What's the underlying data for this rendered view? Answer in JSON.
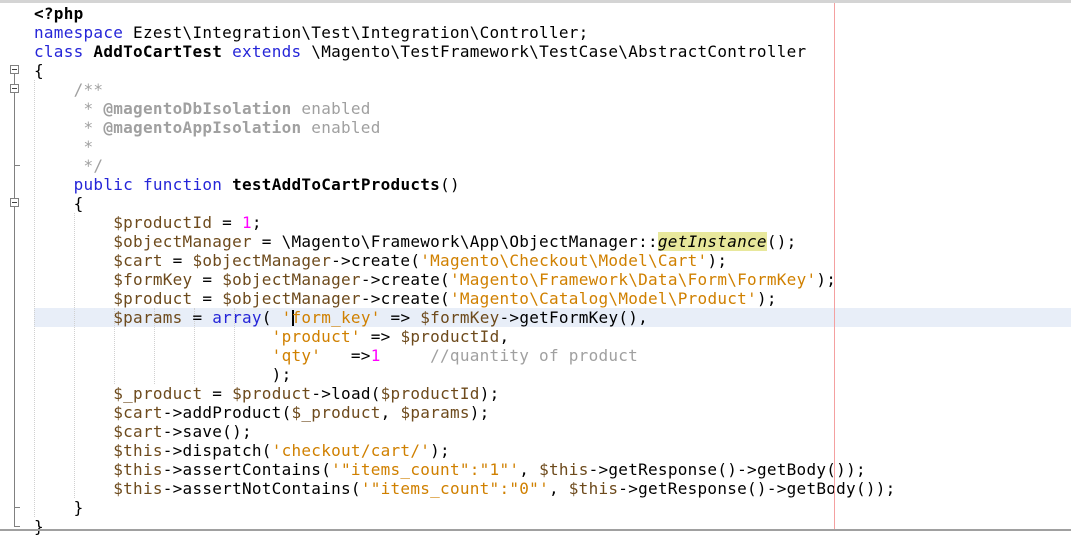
{
  "editor": {
    "current_line": 16,
    "colors": {
      "keyword": "#2525d8",
      "variable": "#6d4a1c",
      "string": "#d08000",
      "number": "#ff00ff",
      "comment": "#a0a0a0",
      "highlight": "#e8e89c",
      "current_line": "#e8eef8",
      "margin_line": "#f4a0a0"
    },
    "fold_markers": [
      4,
      5,
      11
    ],
    "lines": [
      [
        [
          "bold",
          "<?php"
        ]
      ],
      [
        [
          "kw",
          "namespace"
        ],
        [
          "txt",
          " Ezest\\Integration\\Test\\Integration\\Controller;"
        ]
      ],
      [
        [
          "kw",
          "class"
        ],
        [
          "txt",
          " "
        ],
        [
          "bold",
          "AddToCartTest"
        ],
        [
          "txt",
          " "
        ],
        [
          "kw",
          "extends"
        ],
        [
          "txt",
          " \\Magento\\TestFramework\\TestCase\\AbstractController"
        ]
      ],
      [
        [
          "txt",
          "{"
        ]
      ],
      [
        [
          "com",
          "    /**"
        ]
      ],
      [
        [
          "com",
          "     * "
        ],
        [
          "tag",
          "@magentoDbIsolation"
        ],
        [
          "com",
          " enabled"
        ]
      ],
      [
        [
          "com",
          "     * "
        ],
        [
          "tag",
          "@magentoAppIsolation"
        ],
        [
          "com",
          " enabled"
        ]
      ],
      [
        [
          "com",
          "     *"
        ]
      ],
      [
        [
          "com",
          "     */"
        ]
      ],
      [
        [
          "txt",
          "    "
        ],
        [
          "kw",
          "public"
        ],
        [
          "txt",
          " "
        ],
        [
          "kw",
          "function"
        ],
        [
          "txt",
          " "
        ],
        [
          "bold",
          "testAddToCartProducts"
        ],
        [
          "txt",
          "()"
        ]
      ],
      [
        [
          "txt",
          "    {"
        ]
      ],
      [
        [
          "txt",
          "        "
        ],
        [
          "var",
          "$productId"
        ],
        [
          "txt",
          " = "
        ],
        [
          "num",
          "1"
        ],
        [
          "txt",
          ";"
        ]
      ],
      [
        [
          "txt",
          "        "
        ],
        [
          "var",
          "$objectManager"
        ],
        [
          "txt",
          " = \\Magento\\Framework\\App\\ObjectManager::"
        ],
        [
          "hl",
          "getInstance"
        ],
        [
          "txt",
          "();"
        ]
      ],
      [
        [
          "txt",
          "        "
        ],
        [
          "var",
          "$cart"
        ],
        [
          "txt",
          " = "
        ],
        [
          "var",
          "$objectManager"
        ],
        [
          "txt",
          "->create("
        ],
        [
          "str",
          "'Magento\\Checkout\\Model\\Cart'"
        ],
        [
          "txt",
          ");"
        ]
      ],
      [
        [
          "txt",
          "        "
        ],
        [
          "var",
          "$formKey"
        ],
        [
          "txt",
          " = "
        ],
        [
          "var",
          "$objectManager"
        ],
        [
          "txt",
          "->create("
        ],
        [
          "str",
          "'Magento\\Framework\\Data\\Form\\FormKey'"
        ],
        [
          "txt",
          ");"
        ]
      ],
      [
        [
          "txt",
          "        "
        ],
        [
          "var",
          "$product"
        ],
        [
          "txt",
          " = "
        ],
        [
          "var",
          "$objectManager"
        ],
        [
          "txt",
          "->create("
        ],
        [
          "str",
          "'Magento\\Catalog\\Model\\Product'"
        ],
        [
          "txt",
          ");"
        ]
      ],
      [
        [
          "txt",
          "        "
        ],
        [
          "var",
          "$params"
        ],
        [
          "txt",
          " = "
        ],
        [
          "kw",
          "array"
        ],
        [
          "txt",
          "( "
        ],
        [
          "str",
          "'"
        ],
        [
          "cursor",
          ""
        ],
        [
          "str",
          "form_key'"
        ],
        [
          "txt",
          " => "
        ],
        [
          "var",
          "$formKey"
        ],
        [
          "txt",
          "->getFormKey(),"
        ]
      ],
      [
        [
          "txt",
          "                        "
        ],
        [
          "str",
          "'product'"
        ],
        [
          "txt",
          " => "
        ],
        [
          "var",
          "$productId"
        ],
        [
          "txt",
          ","
        ]
      ],
      [
        [
          "txt",
          "                        "
        ],
        [
          "str",
          "'qty'"
        ],
        [
          "txt",
          "   =>"
        ],
        [
          "num",
          "1"
        ],
        [
          "txt",
          "     "
        ],
        [
          "com",
          "//quantity of product"
        ]
      ],
      [
        [
          "txt",
          "                        );"
        ]
      ],
      [
        [
          "txt",
          "        "
        ],
        [
          "var",
          "$_product"
        ],
        [
          "txt",
          " = "
        ],
        [
          "var",
          "$product"
        ],
        [
          "txt",
          "->load("
        ],
        [
          "var",
          "$productId"
        ],
        [
          "txt",
          ");"
        ]
      ],
      [
        [
          "txt",
          "        "
        ],
        [
          "var",
          "$cart"
        ],
        [
          "txt",
          "->addProduct("
        ],
        [
          "var",
          "$_product"
        ],
        [
          "txt",
          ", "
        ],
        [
          "var",
          "$params"
        ],
        [
          "txt",
          ");"
        ]
      ],
      [
        [
          "txt",
          "        "
        ],
        [
          "var",
          "$cart"
        ],
        [
          "txt",
          "->save();"
        ]
      ],
      [
        [
          "txt",
          "        "
        ],
        [
          "var",
          "$this"
        ],
        [
          "txt",
          "->dispatch("
        ],
        [
          "str",
          "'checkout/cart/'"
        ],
        [
          "txt",
          ");"
        ]
      ],
      [
        [
          "txt",
          "        "
        ],
        [
          "var",
          "$this"
        ],
        [
          "txt",
          "->assertContains("
        ],
        [
          "str",
          "'\"items_count\":\"1\"'"
        ],
        [
          "txt",
          ", "
        ],
        [
          "var",
          "$this"
        ],
        [
          "txt",
          "->getResponse()->getBody());"
        ]
      ],
      [
        [
          "txt",
          "        "
        ],
        [
          "var",
          "$this"
        ],
        [
          "txt",
          "->assertNotContains("
        ],
        [
          "str",
          "'\"items_count\":\"0\"'"
        ],
        [
          "txt",
          ", "
        ],
        [
          "var",
          "$this"
        ],
        [
          "txt",
          "->getResponse()->getBody());"
        ]
      ],
      [
        [
          "txt",
          "    }"
        ]
      ],
      [
        [
          "txt",
          "}"
        ]
      ]
    ]
  }
}
